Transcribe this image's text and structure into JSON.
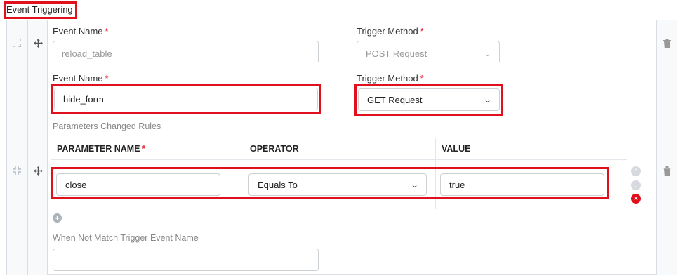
{
  "section": {
    "title": "Event Triggering"
  },
  "rows": [
    {
      "event_name_label": "Event Name",
      "event_name_value": "reload_table",
      "trigger_method_label": "Trigger Method",
      "trigger_method_value": "POST Request"
    },
    {
      "event_name_label": "Event Name",
      "event_name_value": "hide_form",
      "trigger_method_label": "Trigger Method",
      "trigger_method_value": "GET Request",
      "params_title": "Parameters Changed Rules",
      "param_headers": {
        "name": "PARAMETER NAME",
        "operator": "OPERATOR",
        "value": "VALUE"
      },
      "param_rows": [
        {
          "name": "close",
          "operator": "Equals To",
          "value": "true"
        }
      ],
      "not_match_label": "When Not Match Trigger Event Name",
      "not_match_value": ""
    }
  ],
  "required_marker": "*",
  "icons": [
    "expand-icon",
    "collapse-icon",
    "move-icon",
    "trash-icon",
    "up-circle-icon",
    "down-circle-icon",
    "remove-circle-icon",
    "add-circle-icon",
    "chevron-down-icon"
  ],
  "colors": {
    "highlight": "#e0101d",
    "rail": "#f7f9fb",
    "border": "#d8dee4"
  }
}
